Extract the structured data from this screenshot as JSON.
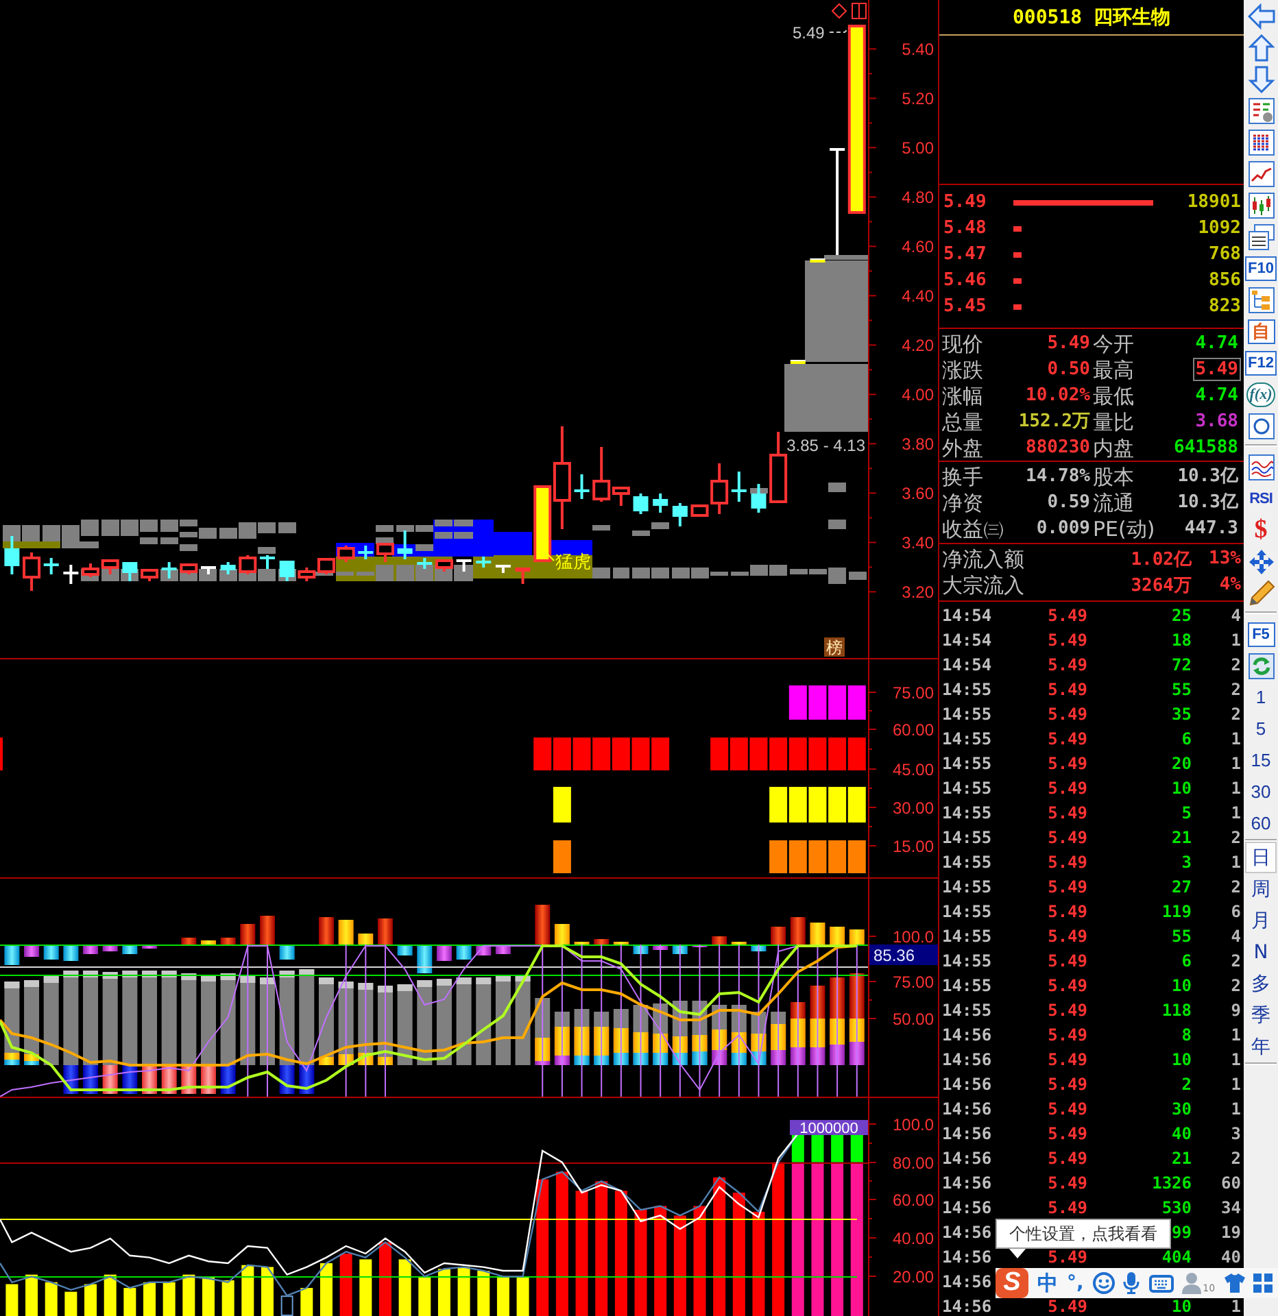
{
  "price_chart": {
    "axis_labels": [
      "5.40",
      "5.20",
      "5.00",
      "4.80",
      "4.60",
      "4.40",
      "4.20",
      "4.00",
      "3.80",
      "3.60",
      "3.40",
      "3.20"
    ],
    "last_price_label": "5.49",
    "range_label": "3.85 - 4.13",
    "signal_label": "猛虎",
    "badge": "榜"
  },
  "signal_chart": {
    "axis_labels": [
      "75.00",
      "60.00",
      "45.00",
      "30.00",
      "15.00"
    ]
  },
  "flow_chart": {
    "axis_labels": [
      "100.0",
      "75.00",
      "50.00"
    ],
    "current_value": "85.36"
  },
  "strength_chart": {
    "axis_labels": [
      "100.0",
      "80.00",
      "60.00",
      "40.00",
      "20.00"
    ],
    "top_label": "1000000"
  },
  "stock": {
    "title": "000518 四环生物"
  },
  "order_book": [
    {
      "price": "5.49",
      "volume": "18901"
    },
    {
      "price": "5.48",
      "volume": "1092"
    },
    {
      "price": "5.47",
      "volume": "768"
    },
    {
      "price": "5.46",
      "volume": "856"
    },
    {
      "price": "5.45",
      "volume": "823"
    }
  ],
  "quote_sections": [
    {
      "rows": [
        {
          "cells": [
            {
              "label": "现价",
              "value": "5.49",
              "color": "#ff3232",
              "boxed": false
            },
            {
              "label": "今开",
              "value": "4.74",
              "color": "#00e600",
              "boxed": false
            }
          ]
        },
        {
          "cells": [
            {
              "label": "涨跌",
              "value": "0.50",
              "color": "#ff3232",
              "boxed": false
            },
            {
              "label": "最高",
              "value": "5.49",
              "color": "#ff3232",
              "boxed": true
            }
          ]
        },
        {
          "cells": [
            {
              "label": "涨幅",
              "value": "10.02%",
              "color": "#ff3232",
              "boxed": false
            },
            {
              "label": "最低",
              "value": "4.74",
              "color": "#00e600",
              "boxed": false
            }
          ]
        },
        {
          "cells": [
            {
              "label": "总量",
              "value": "152.2万",
              "color": "#c8c832",
              "boxed": false
            },
            {
              "label": "量比",
              "value": "3.68",
              "color": "#c832c8",
              "boxed": false
            }
          ]
        },
        {
          "cells": [
            {
              "label": "外盘",
              "value": "880230",
              "color": "#ff3232",
              "boxed": false
            },
            {
              "label": "内盘",
              "value": "641588",
              "color": "#00e600",
              "boxed": false
            }
          ]
        }
      ]
    },
    {
      "rows": [
        {
          "cells": [
            {
              "label": "换手",
              "value": "14.78%",
              "color": "#c0c0c0",
              "boxed": false
            },
            {
              "label": "股本",
              "value": "10.3亿",
              "color": "#c0c0c0",
              "boxed": false
            }
          ]
        },
        {
          "cells": [
            {
              "label": "净资",
              "value": "0.59",
              "color": "#c0c0c0",
              "boxed": false
            },
            {
              "label": "流通",
              "value": "10.3亿",
              "color": "#c0c0c0",
              "boxed": false
            }
          ]
        },
        {
          "cells": [
            {
              "label": "收益㈢",
              "value": "0.009",
              "color": "#c0c0c0",
              "boxed": false
            },
            {
              "label": "PE(动)",
              "value": "447.3",
              "color": "#c0c0c0",
              "boxed": false
            }
          ]
        }
      ]
    }
  ],
  "fund_flow": [
    {
      "label": "净流入额",
      "value": "1.02亿",
      "share": "13%"
    },
    {
      "label": "大宗流入",
      "value": "3264万",
      "share": "4%"
    }
  ],
  "trades": [
    {
      "time": "14:54",
      "price": "5.49",
      "volume": "25",
      "count": "4"
    },
    {
      "time": "14:54",
      "price": "5.49",
      "volume": "18",
      "count": "1"
    },
    {
      "time": "14:54",
      "price": "5.49",
      "volume": "72",
      "count": "2"
    },
    {
      "time": "14:55",
      "price": "5.49",
      "volume": "55",
      "count": "2"
    },
    {
      "time": "14:55",
      "price": "5.49",
      "volume": "35",
      "count": "2"
    },
    {
      "time": "14:55",
      "price": "5.49",
      "volume": "6",
      "count": "1"
    },
    {
      "time": "14:55",
      "price": "5.49",
      "volume": "20",
      "count": "1"
    },
    {
      "time": "14:55",
      "price": "5.49",
      "volume": "10",
      "count": "1"
    },
    {
      "time": "14:55",
      "price": "5.49",
      "volume": "5",
      "count": "1"
    },
    {
      "time": "14:55",
      "price": "5.49",
      "volume": "21",
      "count": "2"
    },
    {
      "time": "14:55",
      "price": "5.49",
      "volume": "3",
      "count": "1"
    },
    {
      "time": "14:55",
      "price": "5.49",
      "volume": "27",
      "count": "2"
    },
    {
      "time": "14:55",
      "price": "5.49",
      "volume": "119",
      "count": "6"
    },
    {
      "time": "14:55",
      "price": "5.49",
      "volume": "55",
      "count": "4"
    },
    {
      "time": "14:55",
      "price": "5.49",
      "volume": "6",
      "count": "2"
    },
    {
      "time": "14:55",
      "price": "5.49",
      "volume": "10",
      "count": "2"
    },
    {
      "time": "14:55",
      "price": "5.49",
      "volume": "118",
      "count": "9"
    },
    {
      "time": "14:56",
      "price": "5.49",
      "volume": "8",
      "count": "1"
    },
    {
      "time": "14:56",
      "price": "5.49",
      "volume": "10",
      "count": "1"
    },
    {
      "time": "14:56",
      "price": "5.49",
      "volume": "2",
      "count": "1"
    },
    {
      "time": "14:56",
      "price": "5.49",
      "volume": "30",
      "count": "1"
    },
    {
      "time": "14:56",
      "price": "5.49",
      "volume": "40",
      "count": "3"
    },
    {
      "time": "14:56",
      "price": "5.49",
      "volume": "21",
      "count": "2"
    },
    {
      "time": "14:56",
      "price": "5.49",
      "volume": "1326",
      "count": "60"
    },
    {
      "time": "14:56",
      "price": "5.49",
      "volume": "530",
      "count": "34"
    },
    {
      "time": "14:56",
      "volume": "99",
      "count": "19"
    },
    {
      "time": "14:56",
      "price": "5.49",
      "volume": "404",
      "count": "40"
    },
    {
      "time": "14:56"
    },
    {
      "time": "14:56",
      "price": "5.49",
      "volume": "10",
      "count": "1"
    }
  ],
  "toolbar": {
    "tiles": [
      "F10",
      "自",
      "F12",
      "f(x)"
    ],
    "rsi": "RSI",
    "dollar": "$",
    "refresh_key": "F5",
    "minute_periods": [
      {
        "label": "1",
        "selected": false
      },
      {
        "label": "5",
        "selected": false
      },
      {
        "label": "15",
        "selected": false
      },
      {
        "label": "30",
        "selected": false
      },
      {
        "label": "60",
        "selected": false
      }
    ],
    "periods": [
      {
        "label": "日",
        "selected": true
      },
      {
        "label": "周",
        "selected": false
      },
      {
        "label": "月",
        "selected": false
      },
      {
        "label": "N",
        "selected": false
      },
      {
        "label": "多",
        "selected": false
      },
      {
        "label": "季",
        "selected": false
      },
      {
        "label": "年",
        "selected": false
      }
    ]
  },
  "ime": {
    "logo": "S",
    "mode": "中",
    "punctuation": "°,",
    "user_badge": "10",
    "tooltip": "个性设置，点我看看"
  }
}
